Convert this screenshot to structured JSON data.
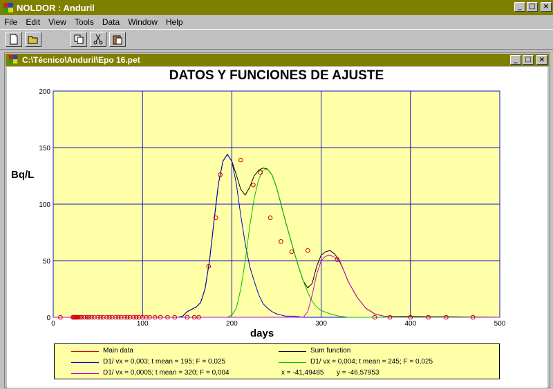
{
  "app": {
    "title": "NOLDOR : Anduril",
    "menu": [
      "File",
      "Edit",
      "View",
      "Tools",
      "Data",
      "Window",
      "Help"
    ],
    "toolbar": [
      "new-icon",
      "open-icon",
      "copy-icon",
      "cut-icon",
      "paste-icon"
    ]
  },
  "document": {
    "path": "C:\\Técnico\\Anduril\\Epo 16.pet"
  },
  "chart_data": {
    "type": "line",
    "title": "DATOS Y FUNCIONES DE AJUSTE",
    "xlabel": "days",
    "ylabel": "Bq/L",
    "xlim": [
      0,
      500
    ],
    "ylim": [
      0,
      200
    ],
    "xticks": [
      "0",
      "100",
      "200",
      "300",
      "400",
      "500"
    ],
    "yticks": [
      "0",
      "50",
      "100",
      "150",
      "200"
    ],
    "grid": true,
    "background": "#ffffa8",
    "points": {
      "name": "Main data",
      "color": "#cc0000",
      "x": [
        8,
        22,
        23,
        24,
        25,
        26,
        27,
        28,
        30,
        32,
        35,
        38,
        40,
        43,
        46,
        50,
        53,
        56,
        60,
        63,
        66,
        70,
        73,
        76,
        80,
        83,
        86,
        90,
        93,
        96,
        100,
        104,
        108,
        114,
        120,
        128,
        136,
        150,
        158,
        163,
        174,
        182,
        187,
        210,
        224,
        232,
        243,
        255,
        267,
        285,
        318,
        360,
        377,
        400,
        420,
        440,
        470
      ],
      "y": [
        0,
        0,
        0,
        0,
        0,
        0,
        0,
        0,
        0,
        0,
        0,
        0,
        0,
        0,
        0,
        0,
        0,
        0,
        0,
        0,
        0,
        0,
        0,
        0,
        0,
        0,
        0,
        0,
        0,
        0,
        0,
        0,
        0,
        0,
        0,
        0,
        0,
        0,
        0,
        0,
        45,
        88,
        126,
        139,
        117,
        128,
        88,
        67,
        58,
        59,
        51,
        0,
        0,
        0,
        0,
        0,
        0
      ]
    },
    "series": [
      {
        "name": "Sum function",
        "color": "#000000",
        "x": [
          0,
          100,
          140,
          145,
          150,
          155,
          160,
          165,
          170,
          175,
          180,
          185,
          190,
          195,
          200,
          205,
          210,
          215,
          220,
          225,
          230,
          235,
          240,
          245,
          250,
          255,
          260,
          265,
          270,
          275,
          280,
          285,
          290,
          295,
          300,
          305,
          310,
          315,
          320,
          325,
          330,
          340,
          350,
          360,
          370,
          500
        ],
        "y": [
          0,
          0,
          0,
          1,
          5,
          7,
          9,
          13,
          25,
          50,
          85,
          118,
          138,
          144,
          138,
          126,
          113,
          108,
          115,
          125,
          130,
          132,
          131,
          126,
          115,
          100,
          85,
          71,
          57,
          44,
          32,
          26,
          30,
          45,
          55,
          58,
          59,
          56,
          51,
          42,
          32,
          18,
          8,
          3,
          1,
          0
        ]
      },
      {
        "name": "D1/ vx = 0,003; t mean = 195; F = 0,025",
        "color": "#0000cc",
        "x": [
          0,
          100,
          140,
          145,
          150,
          155,
          160,
          165,
          170,
          175,
          180,
          185,
          190,
          195,
          200,
          205,
          210,
          215,
          220,
          225,
          230,
          235,
          240,
          245,
          250,
          255,
          260,
          270,
          280,
          290,
          500
        ],
        "y": [
          0,
          0,
          0,
          1,
          5,
          7,
          9,
          13,
          25,
          50,
          85,
          118,
          138,
          144,
          138,
          118,
          90,
          65,
          45,
          32,
          20,
          12,
          8,
          5,
          3,
          2,
          1,
          1,
          0,
          0,
          0
        ]
      },
      {
        "name": "D1/ vx = 0,004; t mean = 245; F = 0,025",
        "color": "#00c000",
        "x": [
          0,
          190,
          195,
          200,
          205,
          210,
          215,
          220,
          225,
          230,
          235,
          240,
          245,
          250,
          255,
          260,
          265,
          270,
          275,
          280,
          285,
          290,
          295,
          300,
          310,
          320,
          330,
          340,
          350,
          360,
          500
        ],
        "y": [
          0,
          0,
          0,
          2,
          8,
          25,
          50,
          80,
          105,
          122,
          130,
          131,
          126,
          115,
          100,
          85,
          71,
          57,
          44,
          32,
          22,
          14,
          9,
          6,
          3,
          1,
          0,
          0,
          0,
          0,
          0
        ]
      },
      {
        "name": "D1/ vx = 0,0005; t mean = 320; F = 0,004",
        "color": "#cc00cc",
        "x": [
          0,
          270,
          280,
          285,
          290,
          295,
          300,
          305,
          310,
          315,
          320,
          325,
          330,
          340,
          350,
          360,
          370,
          500
        ],
        "y": [
          0,
          0,
          0,
          5,
          20,
          38,
          50,
          54,
          55,
          53,
          50,
          42,
          32,
          18,
          8,
          3,
          1,
          0
        ]
      }
    ],
    "legend": [
      {
        "label": "Main data",
        "color": "#cc0000"
      },
      {
        "label": "Sum function",
        "color": "#000000"
      },
      {
        "label": "D1/ vx = 0,003; t mean = 195; F = 0,025",
        "color": "#0000cc"
      },
      {
        "label": "D1/ vx = 0,004; t mean = 245; F = 0,025",
        "color": "#00c000"
      },
      {
        "label": "D1/ vx = 0,0005; t mean = 320; F = 0,004",
        "color": "#cc00cc"
      }
    ],
    "cursor_x": "x = -41,49485",
    "cursor_y": "y = -46,57953"
  }
}
